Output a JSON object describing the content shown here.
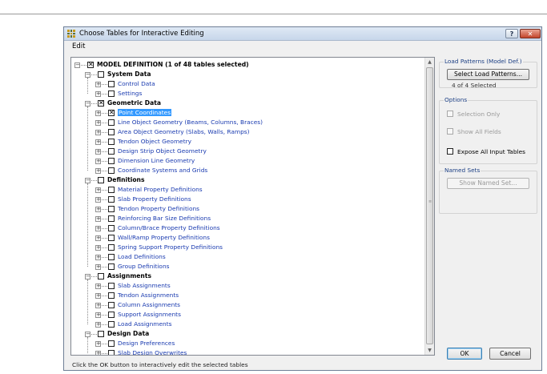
{
  "window": {
    "title": "Choose Tables for Interactive Editing",
    "help_label": "?",
    "close_label": "✕",
    "menu": [
      "Edit"
    ]
  },
  "tree": {
    "root": {
      "label": "MODEL DEFINITION  (1 of 48 tables selected)",
      "checked": true
    },
    "groups": [
      {
        "label": "System Data",
        "checked": false,
        "items": [
          {
            "label": "Control Data",
            "checked": false
          },
          {
            "label": "Settings",
            "checked": false
          }
        ]
      },
      {
        "label": "Geometric Data",
        "checked": true,
        "items": [
          {
            "label": "Point Coordinates",
            "checked": true,
            "selected": true
          },
          {
            "label": "Line Object Geometry (Beams, Columns, Braces)",
            "checked": false
          },
          {
            "label": "Area Object Geometry (Slabs, Walls, Ramps)",
            "checked": false
          },
          {
            "label": "Tendon Object Geometry",
            "checked": false
          },
          {
            "label": "Design Strip Object Geometry",
            "checked": false
          },
          {
            "label": "Dimension Line Geometry",
            "checked": false
          },
          {
            "label": "Coordinate Systems and Grids",
            "checked": false
          }
        ]
      },
      {
        "label": "Definitions",
        "checked": false,
        "items": [
          {
            "label": "Material Property Definitions",
            "checked": false
          },
          {
            "label": "Slab Property Definitions",
            "checked": false
          },
          {
            "label": "Tendon Property Definitions",
            "checked": false
          },
          {
            "label": "Reinforcing Bar Size Definitions",
            "checked": false
          },
          {
            "label": "Column/Brace Property Definitions",
            "checked": false
          },
          {
            "label": "Wall/Ramp Property Definitions",
            "checked": false
          },
          {
            "label": "Spring Support Property Definitions",
            "checked": false
          },
          {
            "label": "Load Definitions",
            "checked": false
          },
          {
            "label": "Group Definitions",
            "checked": false
          }
        ]
      },
      {
        "label": "Assignments",
        "checked": false,
        "items": [
          {
            "label": "Slab Assignments",
            "checked": false
          },
          {
            "label": "Tendon Assignments",
            "checked": false
          },
          {
            "label": "Column Assignments",
            "checked": false
          },
          {
            "label": "Support Assignments",
            "checked": false
          },
          {
            "label": "Load Assignments",
            "checked": false
          }
        ]
      },
      {
        "label": "Design Data",
        "checked": false,
        "items": [
          {
            "label": "Design Preferences",
            "checked": false
          },
          {
            "label": "Slab Design Overwrites",
            "checked": false
          }
        ]
      }
    ]
  },
  "load_patterns": {
    "group_label": "Load Patterns (Model Def.)",
    "button_label": "Select Load Patterns...",
    "status": "4 of 4 Selected"
  },
  "options": {
    "group_label": "Options",
    "selection_only": {
      "label": "Selection Only",
      "checked": false,
      "enabled": false
    },
    "show_all_fields": {
      "label": "Show All Fields",
      "checked": false,
      "enabled": false
    },
    "expose_all_input_tables": {
      "label": "Expose All Input Tables",
      "checked": false,
      "enabled": true
    }
  },
  "named_sets": {
    "group_label": "Named Sets",
    "button_label": "Show Named Set..."
  },
  "status_text": "Click the OK button to interactively edit the selected tables",
  "ok_label": "OK",
  "cancel_label": "Cancel",
  "scroll_grip": "≡"
}
